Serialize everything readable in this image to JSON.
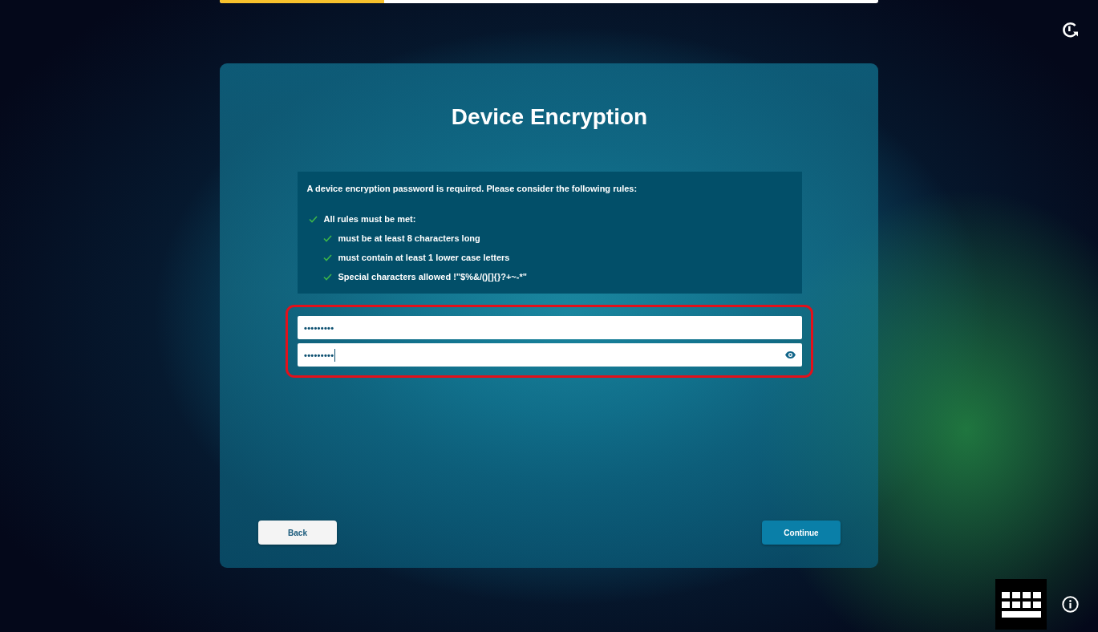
{
  "progress": {
    "level": 0.25
  },
  "title": "Device Encryption",
  "rules_box": {
    "intro": "A device encryption password is required. Please consider the following rules:",
    "rules": [
      {
        "text": "All rules must be met:",
        "met": true,
        "children": [
          {
            "text": "must be at least 8 characters long",
            "met": true
          },
          {
            "text": "must contain at least 1 lower case letters",
            "met": true
          },
          {
            "text": "Special characters allowed !\"$%&/()[]{}?+~-*\"",
            "met": true
          }
        ]
      }
    ]
  },
  "password_group": {
    "highlighted": true,
    "fields": [
      {
        "value": "•••••••••",
        "focused": false,
        "reveal_button": false
      },
      {
        "value": "•••••••••",
        "focused": true,
        "reveal_button": true
      }
    ]
  },
  "buttons": [
    {
      "label": "Back",
      "kind": "secondary"
    },
    {
      "label": "Continue",
      "kind": "primary"
    }
  ]
}
